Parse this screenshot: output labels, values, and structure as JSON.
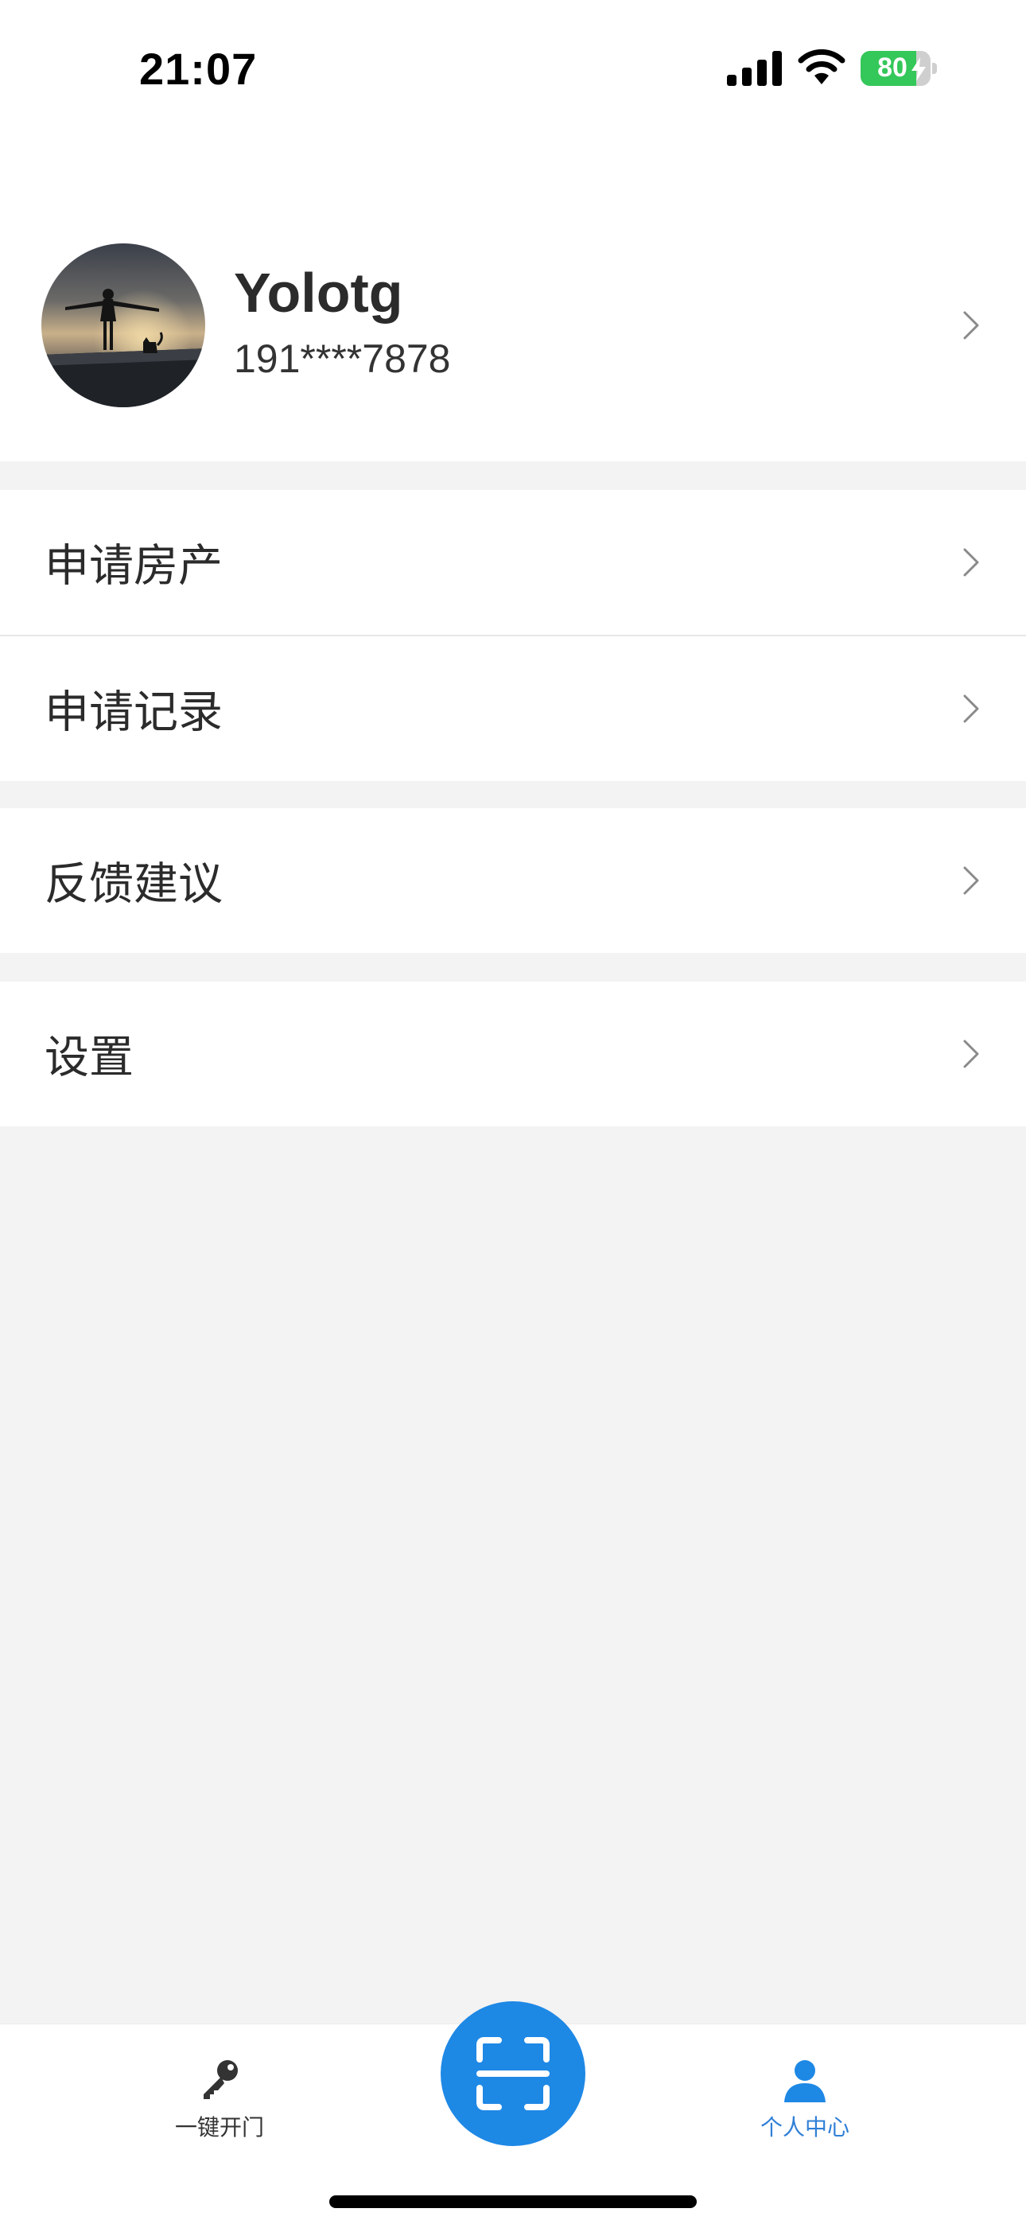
{
  "status_bar": {
    "time": "21:07",
    "battery_level": "80",
    "battery_fraction": 0.8,
    "battery_charging": true,
    "icons": [
      "cellular-signal-icon",
      "wifi-icon",
      "battery-icon",
      "charging-bolt-icon"
    ]
  },
  "profile": {
    "username": "Yolotg",
    "phone": "191****7878",
    "avatar": "avatar-photo",
    "chevron": "chevron-right-icon"
  },
  "menu": {
    "items": [
      {
        "label": "申请房产"
      },
      {
        "label": "申请记录"
      },
      {
        "label": "反馈建议"
      },
      {
        "label": "设置"
      }
    ]
  },
  "tab_bar": {
    "tabs": [
      {
        "label": "一键开门",
        "icon": "key-icon",
        "active": false
      },
      {
        "label": "个人中心",
        "icon": "person-icon",
        "active": true
      }
    ],
    "center_button_icon": "scan-icon"
  },
  "colors": {
    "accent": "#1e88e5",
    "active_tab": "#2f7fd6",
    "inactive_tab": "#333333",
    "battery_green": "#34c759",
    "background": "#f3f3f3"
  }
}
